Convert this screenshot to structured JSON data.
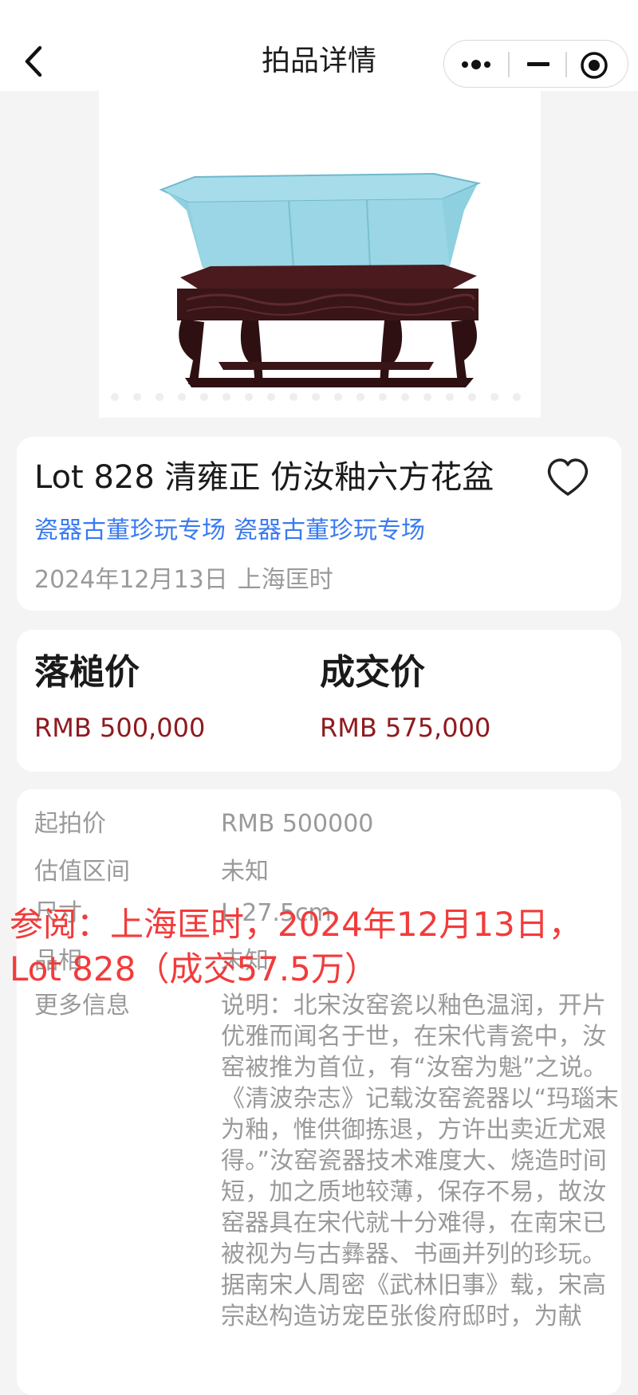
{
  "nav": {
    "title": "拍品详情",
    "icons": {
      "back": "chevron-left-icon",
      "more": "more-dots-icon",
      "minimize": "minimize-icon",
      "close": "target-close-icon"
    }
  },
  "hero": {
    "image_icon": "celadon-hexagonal-flowerpot-image",
    "glaze_color": "#8fd0e0",
    "stand_color": "#3a1518"
  },
  "lot": {
    "title": "Lot 828 清雍正 仿汝釉六方花盆",
    "sessions": [
      "瓷器古董珍玩专场",
      "瓷器古董珍玩专场"
    ],
    "date": "2024年12月13日",
    "house": "上海匡时",
    "favorite_icon": "heart-outline-icon"
  },
  "prices": {
    "hammer_label": "落槌价",
    "hammer_value": "RMB 500,000",
    "deal_label": "成交价",
    "deal_value": "RMB 575,000"
  },
  "details": [
    {
      "key": "起拍价",
      "value": "RMB 500000"
    },
    {
      "key": "估值区间",
      "value": "未知"
    },
    {
      "key": "尺寸",
      "value": "L 27.5cm"
    },
    {
      "key": "品相",
      "value": "未知"
    },
    {
      "key": "更多信息",
      "value": "说明：北宋汝窑瓷以釉色温润，开片优雅而闻名于世，在宋代青瓷中，汝窑被推为首位，有“汝窑为魁”之说。《清波杂志》记载汝窑瓷器以“玛瑙末为釉，惟供御拣退，方许出卖近尤艰得。”汝窑瓷器技术难度大、烧造时间短，加之质地较薄，保存不易，故汝窑器具在宋代就十分难得，在南宋已被视为与古彝器、书画并列的珍玩。据南宋人周密《武林旧事》载，宋高宗赵构造访宠臣张俊府邸时，为献"
    }
  ],
  "overlay": {
    "text": "参阅：上海匡时，2024年12月13日，Lot 828（成交57.5万）",
    "color": "#f23b3b"
  },
  "colors": {
    "accent_link": "#3a7bf0",
    "price": "#8e1a1f",
    "muted": "#9a9a9a",
    "background": "#f4f4f4"
  }
}
